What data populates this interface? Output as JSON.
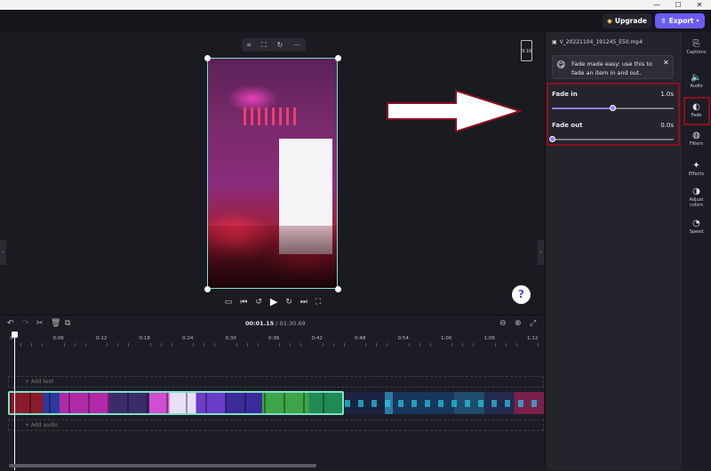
{
  "window": {
    "minimize": "—",
    "maximize": "☐",
    "close": "✕"
  },
  "header": {
    "upgrade_label": "Upgrade",
    "export_label": "Export"
  },
  "preview": {
    "ratio_label": "9:16",
    "toolbar_icons": [
      "crop-icon",
      "fit-icon",
      "rotate-icon",
      "more-icon"
    ],
    "playback_icons": [
      "captions-toggle-icon",
      "skip-back-icon",
      "rewind-5-icon",
      "play-icon",
      "forward-5-icon",
      "skip-forward-icon",
      "fullscreen-icon"
    ]
  },
  "help_label": "?",
  "panel": {
    "file_name": "V_20221104_191245_E50.mp4",
    "tip_text_1": "Fade made easy: use this to",
    "tip_text_2": "fade an item in and out.",
    "tip_close": "✕",
    "fade_in": {
      "label": "Fade in",
      "value": "1.0s",
      "fraction": 0.5
    },
    "fade_out": {
      "label": "Fade out",
      "value": "0.0s",
      "fraction": 0.0
    }
  },
  "rail": [
    {
      "name": "captions",
      "label": "Captions",
      "icon": "⎘"
    },
    {
      "name": "audio",
      "label": "Audio",
      "icon": "🔈"
    },
    {
      "name": "fade",
      "label": "Fade",
      "icon": "◐"
    },
    {
      "name": "filters",
      "label": "Filters",
      "icon": "◍"
    },
    {
      "name": "effects",
      "label": "Effects",
      "icon": "✦"
    },
    {
      "name": "adjust",
      "label": "Adjust colors",
      "icon": "◑"
    },
    {
      "name": "speed",
      "label": "Speed",
      "icon": "◔"
    }
  ],
  "timeline": {
    "current_time": "00:01.15",
    "total_time": "/ 01:30.69",
    "ruler": [
      "0",
      "0:06",
      "0:12",
      "0:18",
      "0:24",
      "0:30",
      "0:36",
      "0:42",
      "0:48",
      "0:54",
      "1:00",
      "1:06",
      "1:12"
    ],
    "add_text": "+ Add text",
    "add_audio": "+ Add audio"
  }
}
